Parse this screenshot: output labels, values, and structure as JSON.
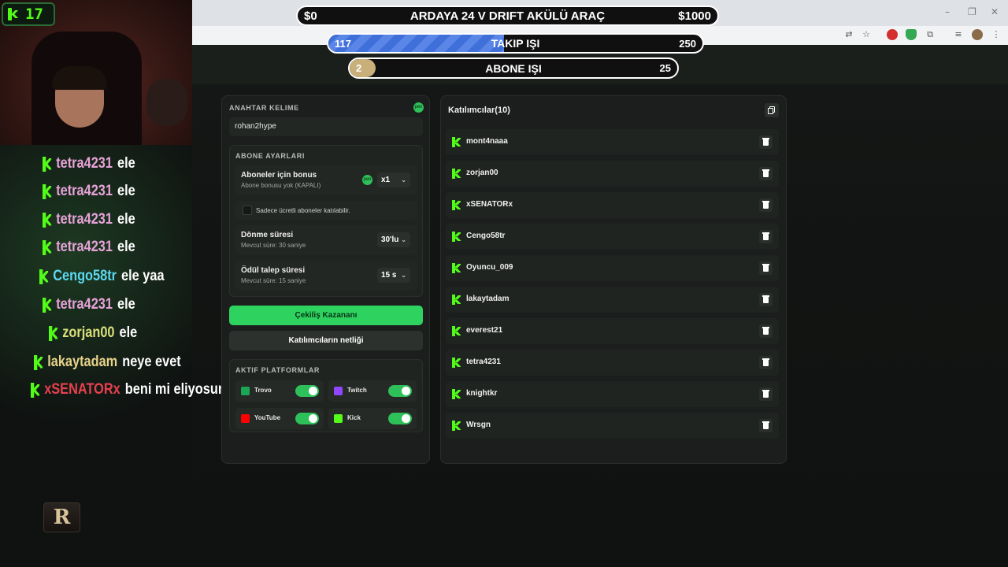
{
  "viewer": {
    "count": "17"
  },
  "goals": [
    {
      "left": "$0",
      "title": "ARDAYA 24 V DRIFT AKÜLÜ ARAÇ",
      "right": "$1000",
      "progress": 0
    },
    {
      "left": "117",
      "title": "TAKIP IŞI",
      "right": "250",
      "progress": 0.47
    },
    {
      "left": "2",
      "title": "ABONE IŞI",
      "right": "25",
      "progress": 0.08
    }
  ],
  "chat": [
    {
      "user": "tetra4231",
      "msg": "ele",
      "color": "#e7a3d8"
    },
    {
      "user": "tetra4231",
      "msg": "ele",
      "color": "#e7a3d8"
    },
    {
      "user": "tetra4231",
      "msg": "ele",
      "color": "#e7a3d8"
    },
    {
      "user": "tetra4231",
      "msg": "ele",
      "color": "#e7a3d8"
    },
    {
      "user": "Cengo58tr",
      "msg": "ele yaa",
      "color": "#5ad8f0"
    },
    {
      "user": "tetra4231",
      "msg": "ele",
      "color": "#e7a3d8"
    },
    {
      "user": "zorjan00",
      "msg": "ele",
      "color": "#d9e07a"
    },
    {
      "user": "lakaytadam",
      "msg": "neye evet",
      "color": "#e8d38a"
    },
    {
      "user": "xSENATORx",
      "msg": "beni mi eliyosunuz",
      "color": "#e8404f"
    }
  ],
  "brand": {
    "logo_letter": "R"
  },
  "settings": {
    "keyword_label": "ANAHTAR KELIME",
    "keyword_value": "rohan2hype",
    "badge_text": "pen",
    "sub_section": "ABONE AYARLARI",
    "bonus_title": "Aboneler için bonus",
    "bonus_sub": "Abone bonusu yok (KAPALI)",
    "bonus_select": "x1",
    "paid_only": "Sadece ücretli aboneler katılabilir.",
    "spin_title": "Dönme süresi",
    "spin_sub": "Mevcut süre: 30 saniye",
    "spin_select": "30'lu",
    "claim_title": "Ödül talep süresi",
    "claim_sub": "Mevcut süre: 15 saniye",
    "claim_select": "15 s",
    "draw_button": "Çekiliş Kazananı",
    "clear_button": "Katılımcıların netliği",
    "platforms_label": "AKTIF PLATFORMLAR",
    "platforms": [
      {
        "name": "Trovo",
        "color": "#1ba653",
        "enabled": true
      },
      {
        "name": "Twitch",
        "color": "#9146ff",
        "enabled": true
      },
      {
        "name": "YouTube",
        "color": "#ff0000",
        "enabled": true
      },
      {
        "name": "Kick",
        "color": "#53fc18",
        "enabled": true
      }
    ]
  },
  "participants": {
    "title": "Katılımcılar(10)",
    "list": [
      "mont4naaa",
      "zorjan00",
      "xSENATORx",
      "Cengo58tr",
      "Oyuncu_009",
      "lakaytadam",
      "everest21",
      "tetra4231",
      "knightkr",
      "Wrsgn"
    ]
  }
}
